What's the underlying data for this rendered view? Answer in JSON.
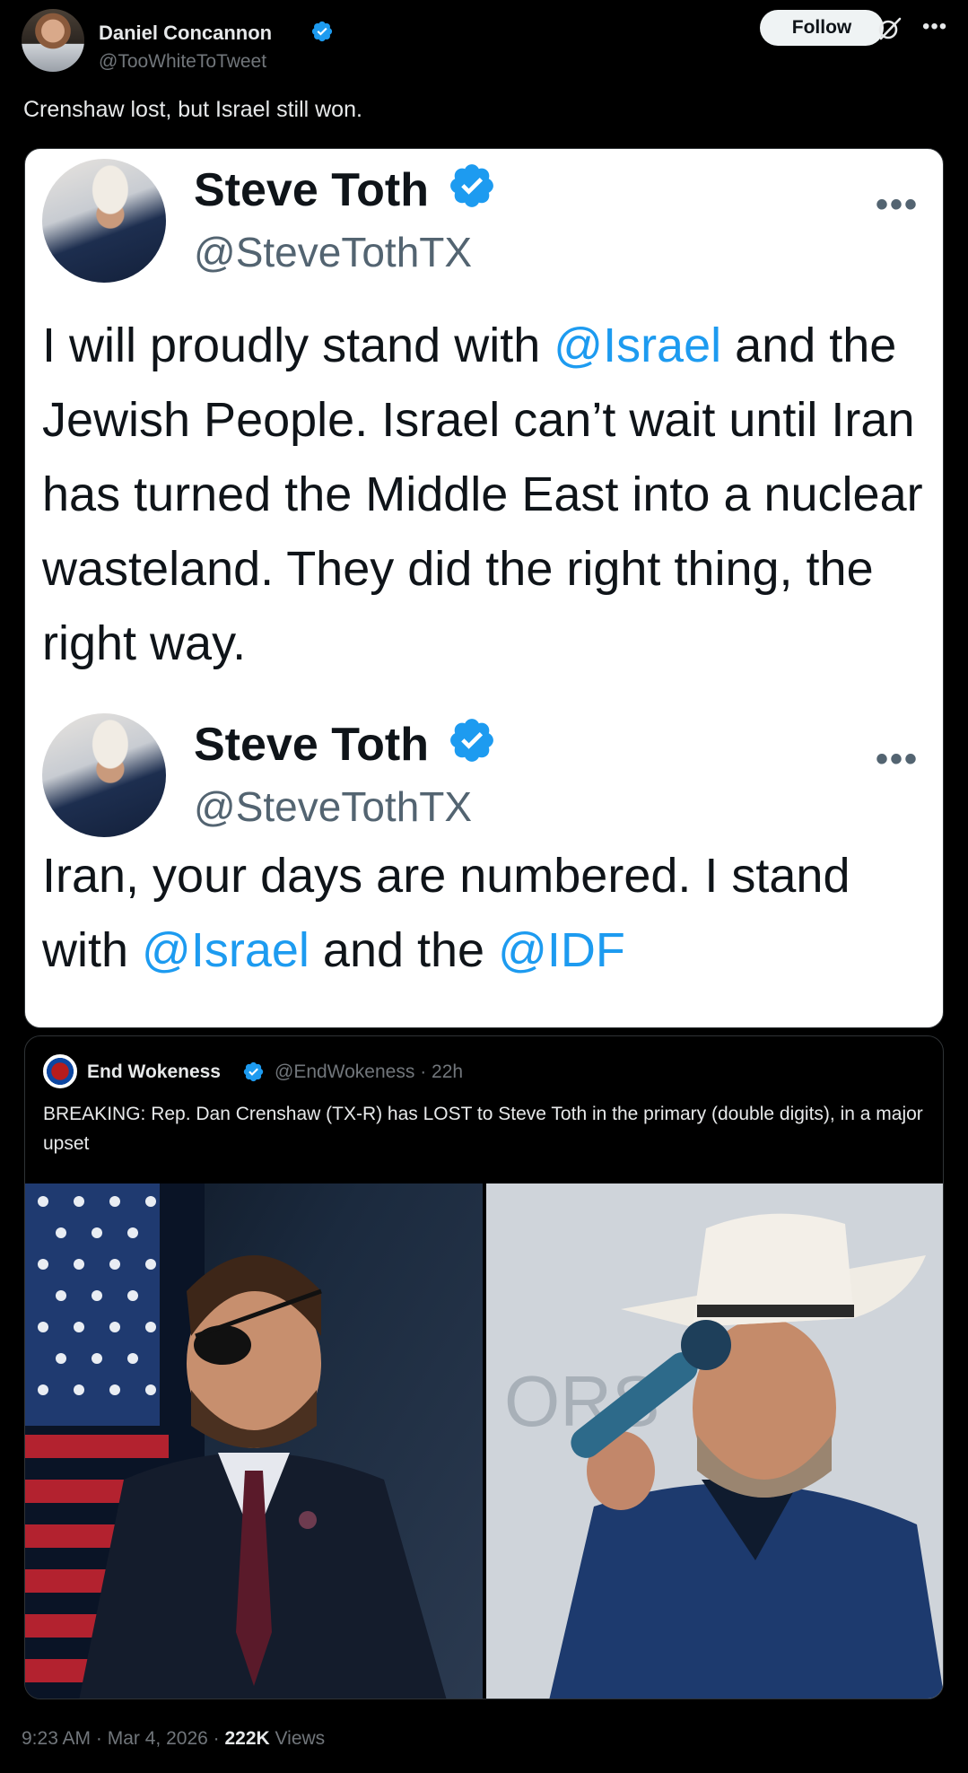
{
  "author": {
    "name": "Daniel Concannon",
    "handle": "@TooWhiteToTweet"
  },
  "header": {
    "follow_label": "Follow"
  },
  "post": {
    "text": "Crenshaw lost, but Israel still won."
  },
  "embedded_image": {
    "tweets": [
      {
        "name": "Steve Toth",
        "handle": "@SteveTothTX",
        "parts": [
          {
            "text": "I will proudly stand with ",
            "mention": false
          },
          {
            "text": "@Israel",
            "mention": true
          },
          {
            "text": " and the Jewish People. Israel can’t wait until Iran has turned the Middle East into a nuclear wasteland. They did the right thing, the right way.",
            "mention": false
          }
        ]
      },
      {
        "name": "Steve Toth",
        "handle": "@SteveTothTX",
        "parts": [
          {
            "text": "Iran, your days are numbered. I stand with ",
            "mention": false
          },
          {
            "text": "@Israel",
            "mention": true
          },
          {
            "text": " and the ",
            "mention": false
          },
          {
            "text": "@IDF",
            "mention": true
          }
        ]
      }
    ]
  },
  "quote": {
    "name": "End Wokeness",
    "handle": "@EndWokeness",
    "time": "22h",
    "text": "BREAKING: Rep. Dan Crenshaw (TX-R) has LOST to Steve Toth in the primary (double digits), in a major upset"
  },
  "footer": {
    "time": "9:23 AM",
    "date": "Mar 4, 2026",
    "views_count": "222K",
    "views_label": "Views"
  },
  "colors": {
    "background": "#000000",
    "accent": "#1d9bf0",
    "text_primary": "#e7e9ea",
    "text_secondary": "#71767b"
  },
  "icons": [
    "verified-badge-icon",
    "grok-icon",
    "more-icon",
    "flag-icon"
  ]
}
